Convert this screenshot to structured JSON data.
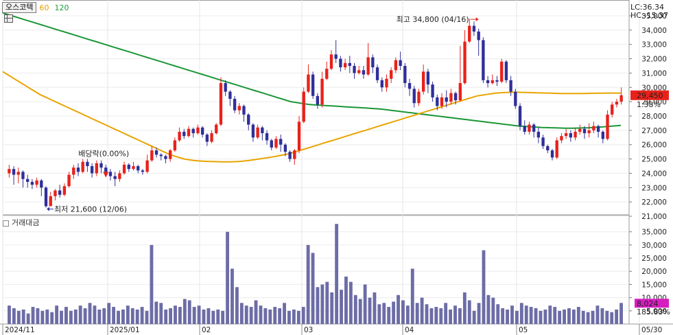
{
  "legend": {
    "name": "오스코텍",
    "ma1": "60",
    "ma2": "120"
  },
  "volume_panel": {
    "title": "거래대금"
  },
  "readout": {
    "lc": "LC:36.34",
    "hc": "HC:-15.37"
  },
  "price_badge": {
    "value": "29,450",
    "change": "1.38%"
  },
  "volume_badge": {
    "value": "8,024",
    "change": "185.83%"
  },
  "annotations": {
    "high": "최고 34,800 (04/16)",
    "low": "최저 21,600 (12/06)",
    "ex_right": "배당락(0.00%)"
  },
  "colors": {
    "up": "#e8221b",
    "down": "#2f2f9a",
    "ma60": "#e8a400",
    "ma120": "#1a9636",
    "volume": "#6c6ca6",
    "badge_price": "#e8221b",
    "badge_volume": "#d61ec0"
  },
  "chart_data": [
    {
      "type": "candlestick",
      "x_labels": [
        "2024/11",
        "2025/01",
        "02",
        "03",
        "04",
        "05",
        "05/30"
      ],
      "ylim": [
        21000,
        35000
      ],
      "yticks": [
        "35,000",
        "34,000",
        "33,000",
        "32,000",
        "31,000",
        "30,000",
        "29,000",
        "28,000",
        "27,000",
        "26,000",
        "25,000",
        "24,000",
        "23,000",
        "22,000",
        "21,000"
      ],
      "last_close": 29450,
      "high": 34800,
      "low": 21600,
      "candles": [
        [
          24000,
          24300,
          24600,
          23700
        ],
        [
          24300,
          23900,
          24500,
          23200
        ],
        [
          23900,
          24100,
          24400,
          23300
        ],
        [
          24100,
          23600,
          24200,
          23000
        ],
        [
          23600,
          23400,
          23900,
          23000
        ],
        [
          23400,
          23200,
          23600,
          22900
        ],
        [
          23200,
          23500,
          23700,
          23000
        ],
        [
          23500,
          23000,
          23600,
          22400
        ],
        [
          23000,
          21700,
          23100,
          21600
        ],
        [
          21700,
          22400,
          22700,
          21800
        ],
        [
          22400,
          22800,
          22900,
          22100
        ],
        [
          22800,
          22500,
          23200,
          22300
        ],
        [
          22500,
          23100,
          23300,
          22400
        ],
        [
          23100,
          23900,
          24100,
          23000
        ],
        [
          23900,
          24400,
          24600,
          23600
        ],
        [
          24400,
          24100,
          24700,
          23800
        ],
        [
          24100,
          24800,
          25000,
          24000
        ],
        [
          24800,
          24500,
          25000,
          24100
        ],
        [
          24500,
          24000,
          24700,
          23700
        ],
        [
          24000,
          24700,
          24900,
          23800
        ],
        [
          24700,
          24400,
          24900,
          24000
        ],
        [
          24400,
          24100,
          24600,
          23800
        ],
        [
          24100,
          23800,
          24300,
          23500
        ],
        [
          23800,
          23600,
          24100,
          23100
        ],
        [
          23600,
          24000,
          24200,
          23400
        ],
        [
          24000,
          24600,
          24800,
          23900
        ],
        [
          24600,
          24300,
          24700,
          24100
        ],
        [
          24300,
          24500,
          24800,
          24200
        ],
        [
          24500,
          24200,
          24600,
          24000
        ],
        [
          24200,
          24100,
          24300,
          23900
        ],
        [
          24100,
          24900,
          25300,
          24000
        ],
        [
          24900,
          25600,
          25900,
          24800
        ],
        [
          25600,
          25300,
          25800,
          25100
        ],
        [
          25300,
          25200,
          25400,
          24900
        ],
        [
          25200,
          25000,
          25300,
          24700
        ],
        [
          25000,
          25600,
          25700,
          24800
        ],
        [
          25600,
          26300,
          26500,
          25500
        ],
        [
          26300,
          26900,
          27200,
          26200
        ],
        [
          26900,
          26600,
          27100,
          26400
        ],
        [
          26600,
          27100,
          27300,
          26500
        ],
        [
          27100,
          26800,
          27200,
          26500
        ],
        [
          26800,
          27200,
          27400,
          26700
        ],
        [
          27200,
          26700,
          27300,
          26500
        ],
        [
          26700,
          26200,
          26800,
          25900
        ],
        [
          26200,
          26800,
          27000,
          26100
        ],
        [
          26800,
          27400,
          27500,
          26700
        ],
        [
          27400,
          30300,
          30700,
          27300
        ],
        [
          30300,
          29700,
          30500,
          29400
        ],
        [
          29700,
          29200,
          29800,
          28700
        ],
        [
          29200,
          28400,
          29400,
          28200
        ],
        [
          28400,
          28700,
          28900,
          28100
        ],
        [
          28700,
          28100,
          28800,
          27600
        ],
        [
          28100,
          27400,
          28200,
          27000
        ],
        [
          27400,
          26500,
          27500,
          26200
        ],
        [
          26500,
          27200,
          27400,
          26400
        ],
        [
          27200,
          26800,
          27300,
          26300
        ],
        [
          26800,
          26300,
          27000,
          26000
        ],
        [
          26300,
          25800,
          26400,
          25600
        ],
        [
          25800,
          26400,
          26600,
          25700
        ],
        [
          26400,
          26000,
          26700,
          25500
        ],
        [
          26000,
          25500,
          26100,
          25200
        ],
        [
          25500,
          25000,
          25600,
          24800
        ],
        [
          25000,
          25600,
          25700,
          24600
        ],
        [
          25600,
          27600,
          28000,
          25400
        ],
        [
          27600,
          29700,
          30000,
          27500
        ],
        [
          29700,
          30900,
          31600,
          29600
        ],
        [
          30900,
          29400,
          31100,
          29200
        ],
        [
          29400,
          28800,
          29600,
          28500
        ],
        [
          28800,
          30600,
          31100,
          28600
        ],
        [
          30600,
          31300,
          31800,
          30500
        ],
        [
          31300,
          32300,
          32600,
          31200
        ],
        [
          32300,
          32000,
          33300,
          31700
        ],
        [
          32000,
          31400,
          32200,
          31100
        ],
        [
          31400,
          31700,
          32000,
          31200
        ],
        [
          31700,
          31500,
          32200,
          31000
        ],
        [
          31500,
          31000,
          31700,
          30600
        ],
        [
          31000,
          31200,
          31500,
          30900
        ],
        [
          31200,
          30900,
          31500,
          30600
        ],
        [
          30900,
          32100,
          33100,
          30800
        ],
        [
          32100,
          31400,
          32300,
          31000
        ],
        [
          31400,
          30500,
          31600,
          30300
        ],
        [
          30500,
          30000,
          30700,
          29700
        ],
        [
          30000,
          30600,
          30900,
          29700
        ],
        [
          30600,
          31200,
          31400,
          30300
        ],
        [
          31200,
          31900,
          32100,
          31000
        ],
        [
          31900,
          31500,
          32500,
          31200
        ],
        [
          31500,
          30300,
          31700,
          30000
        ],
        [
          30300,
          29900,
          30600,
          29400
        ],
        [
          29900,
          28900,
          30100,
          28600
        ],
        [
          28900,
          29700,
          29900,
          28700
        ],
        [
          29700,
          31100,
          31600,
          29500
        ],
        [
          31100,
          30200,
          31300,
          29600
        ],
        [
          30200,
          29300,
          30400,
          29000
        ],
        [
          29300,
          28700,
          29500,
          28400
        ],
        [
          28700,
          29300,
          29600,
          28500
        ],
        [
          29300,
          29000,
          29800,
          28600
        ],
        [
          29000,
          29600,
          29900,
          28800
        ],
        [
          29600,
          29100,
          29700,
          28800
        ],
        [
          29100,
          30300,
          32900,
          29000
        ],
        [
          30300,
          33200,
          34000,
          30200
        ],
        [
          33200,
          34300,
          34800,
          33100
        ],
        [
          34300,
          33900,
          34600,
          33600
        ],
        [
          33900,
          33300,
          34100,
          32200
        ],
        [
          33300,
          30500,
          33500,
          30300
        ],
        [
          30500,
          30300,
          30800,
          30000
        ],
        [
          30300,
          30500,
          30900,
          30200
        ],
        [
          30500,
          30400,
          30800,
          30100
        ],
        [
          30400,
          31800,
          32000,
          30300
        ],
        [
          31800,
          30500,
          31900,
          30300
        ],
        [
          30500,
          29700,
          30800,
          29400
        ],
        [
          29700,
          28700,
          29900,
          28500
        ],
        [
          28700,
          27300,
          28900,
          27000
        ],
        [
          27300,
          26900,
          27700,
          26700
        ],
        [
          26900,
          27400,
          27600,
          26700
        ],
        [
          27400,
          26900,
          27500,
          26500
        ],
        [
          26900,
          26500,
          27200,
          26100
        ],
        [
          26500,
          25900,
          26700,
          25700
        ],
        [
          25900,
          25600,
          26000,
          25400
        ],
        [
          25600,
          25100,
          25700,
          24900
        ],
        [
          25100,
          26300,
          26500,
          25000
        ],
        [
          26300,
          26600,
          26800,
          26100
        ],
        [
          26600,
          26800,
          27100,
          26400
        ],
        [
          26800,
          26500,
          27000,
          26200
        ],
        [
          26500,
          26900,
          27200,
          26300
        ],
        [
          26900,
          27100,
          27400,
          26700
        ],
        [
          27100,
          26800,
          27300,
          26400
        ],
        [
          26800,
          27000,
          27500,
          26500
        ],
        [
          27000,
          27300,
          27600,
          26800
        ],
        [
          27300,
          26900,
          27400,
          26500
        ],
        [
          26900,
          26400,
          27000,
          26100
        ],
        [
          26400,
          28100,
          28400,
          26300
        ],
        [
          28100,
          28800,
          29000,
          27900
        ],
        [
          28800,
          29000,
          29200,
          28600
        ],
        [
          29000,
          29450,
          30000,
          28800
        ]
      ],
      "ma60": [
        31100,
        30900,
        30700,
        30500,
        30300,
        30100,
        29900,
        29700,
        29500,
        29350,
        29200,
        29050,
        28900,
        28750,
        28600,
        28450,
        28300,
        28150,
        28000,
        27850,
        27700,
        27550,
        27400,
        27250,
        27100,
        26950,
        26800,
        26650,
        26500,
        26350,
        26200,
        26050,
        25900,
        25750,
        25600,
        25450,
        25300,
        25200,
        25100,
        25000,
        24950,
        24900,
        24870,
        24850,
        24830,
        24820,
        24810,
        24800,
        24800,
        24800,
        24810,
        24830,
        24860,
        24900,
        24940,
        24990,
        25040,
        25090,
        25140,
        25200,
        25260,
        25320,
        25400,
        25500,
        25600,
        25700,
        25800,
        25900,
        26000,
        26100,
        26200,
        26300,
        26400,
        26500,
        26600,
        26700,
        26800,
        26900,
        27000,
        27100,
        27200,
        27300,
        27400,
        27500,
        27600,
        27700,
        27800,
        27900,
        28000,
        28100,
        28200,
        28300,
        28400,
        28500,
        28600,
        28700,
        28800,
        28900,
        29000,
        29100,
        29200,
        29300,
        29400,
        29450,
        29500,
        29550,
        29600,
        29620,
        29640,
        29650,
        29660,
        29660,
        29650,
        29640,
        29630,
        29620,
        29610,
        29600,
        29590,
        29580,
        29575,
        29570,
        29570,
        29570,
        29570,
        29575,
        29580,
        29585,
        29590,
        29595,
        29600,
        29600,
        29600,
        29600
      ],
      "ma120": [
        35200,
        35100,
        35000,
        34900,
        34800,
        34700,
        34600,
        34500,
        34400,
        34300,
        34200,
        34100,
        34000,
        33900,
        33800,
        33700,
        33600,
        33500,
        33400,
        33300,
        33200,
        33100,
        33000,
        32900,
        32800,
        32700,
        32600,
        32500,
        32400,
        32300,
        32200,
        32100,
        32000,
        31900,
        31800,
        31700,
        31600,
        31500,
        31400,
        31300,
        31200,
        31100,
        31000,
        30900,
        30800,
        30700,
        30600,
        30500,
        30400,
        30300,
        30200,
        30100,
        30000,
        29900,
        29800,
        29700,
        29600,
        29500,
        29400,
        29300,
        29200,
        29100,
        29000,
        28950,
        28900,
        28850,
        28800,
        28780,
        28760,
        28740,
        28720,
        28700,
        28680,
        28660,
        28640,
        28620,
        28600,
        28580,
        28560,
        28540,
        28520,
        28500,
        28460,
        28420,
        28380,
        28340,
        28300,
        28260,
        28220,
        28180,
        28140,
        28100,
        28060,
        28020,
        27980,
        27940,
        27900,
        27860,
        27820,
        27780,
        27740,
        27700,
        27660,
        27620,
        27580,
        27540,
        27500,
        27460,
        27420,
        27380,
        27340,
        27300,
        27280,
        27260,
        27240,
        27220,
        27200,
        27190,
        27180,
        27170,
        27160,
        27150,
        27150,
        27150,
        27160,
        27170,
        27180,
        27200,
        27220,
        27240,
        27260,
        27290,
        27320,
        27350
      ]
    },
    {
      "type": "bar",
      "title": "거래대금",
      "ylim": [
        0,
        37000
      ],
      "yticks": [
        "35,000",
        "30,000",
        "25,000",
        "20,000",
        "15,000",
        "10,000",
        "5,000"
      ],
      "last_value": 8024,
      "values": [
        7000,
        6000,
        5000,
        5500,
        4000,
        6500,
        6000,
        5000,
        5500,
        4500,
        7000,
        5000,
        6500,
        5000,
        5500,
        7000,
        6000,
        8000,
        7000,
        5500,
        6000,
        8000,
        6500,
        5000,
        5500,
        7000,
        6000,
        5500,
        6500,
        5000,
        30000,
        8500,
        8000,
        5500,
        6000,
        7000,
        6500,
        9500,
        9000,
        6500,
        7000,
        5500,
        6000,
        5000,
        5500,
        5000,
        35000,
        21000,
        14000,
        8000,
        7000,
        6500,
        9000,
        7000,
        6000,
        5500,
        6500,
        6000,
        8000,
        5000,
        5500,
        5000,
        6500,
        30000,
        27000,
        14000,
        15000,
        16000,
        12000,
        38000,
        13000,
        18000,
        16000,
        11000,
        9500,
        15000,
        10000,
        12000,
        7500,
        8000,
        6500,
        8500,
        11000,
        9000,
        7000,
        21000,
        8000,
        10000,
        7500,
        6000,
        6500,
        6000,
        8000,
        5500,
        7000,
        6000,
        12000,
        9000,
        5000,
        8000,
        28000,
        11000,
        10000,
        7500,
        6000,
        5500,
        7000,
        5000,
        8000,
        7000,
        6500,
        6000,
        5000,
        5500,
        7000,
        6500,
        5000,
        5500,
        6000,
        5500,
        6500,
        5000,
        4500,
        5000,
        7000,
        6000,
        5000,
        4500,
        5500,
        8000
      ]
    }
  ]
}
